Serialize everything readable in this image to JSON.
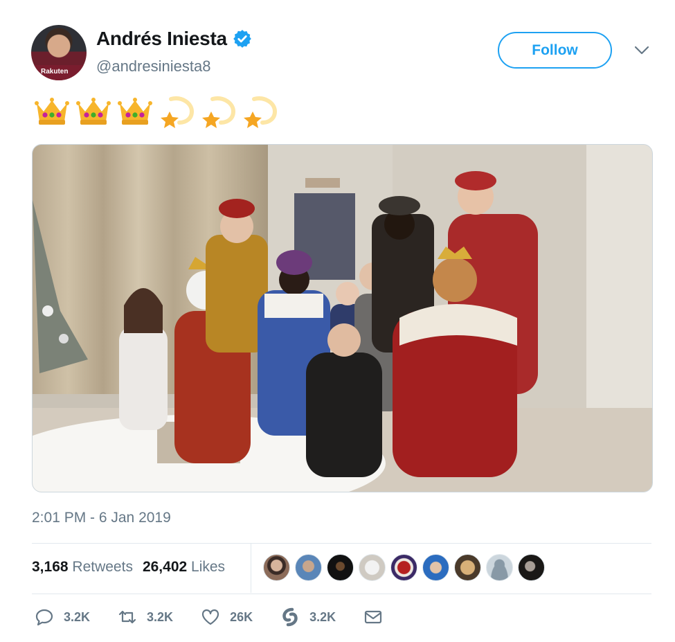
{
  "author": {
    "display_name": "Andrés Iniesta",
    "handle": "@andresiniesta8",
    "verified": true,
    "avatar_sponsor_text": "Rakuten"
  },
  "follow_button": {
    "label": "Follow"
  },
  "tweet": {
    "emojis": [
      "crown",
      "crown",
      "crown",
      "shooting-star",
      "shooting-star",
      "shooting-star"
    ],
    "timestamp": "2:01 PM - 6 Jan 2019"
  },
  "stats": {
    "retweets_count": "3,168",
    "retweets_label": "Retweets",
    "likes_count": "26,402",
    "likes_label": "Likes"
  },
  "actions": {
    "reply_count": "3.2K",
    "retweet_count": "3.2K",
    "like_count": "26K",
    "moments_count": "3.2K"
  },
  "colors": {
    "accent": "#1da1f2",
    "secondary_text": "#657786",
    "divider": "#e1e8ed"
  }
}
